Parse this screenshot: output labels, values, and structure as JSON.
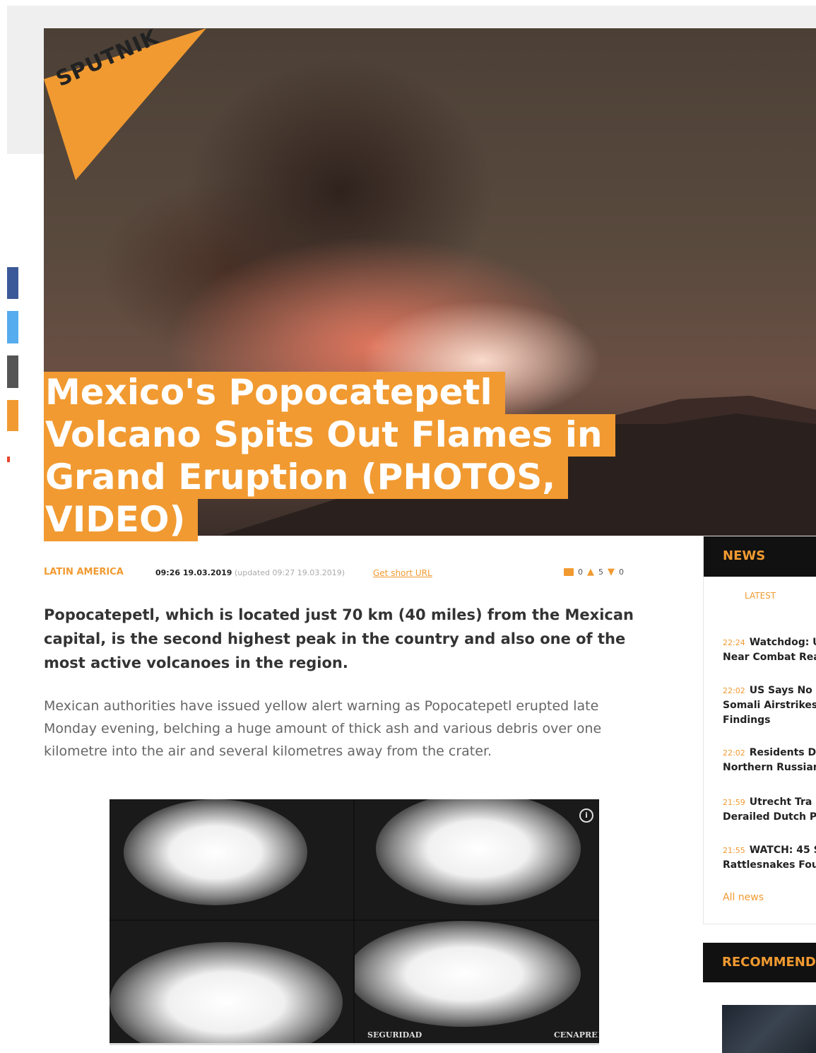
{
  "brand": {
    "logo_text": "SPUTNIK",
    "accent": "#f19a31"
  },
  "article": {
    "headline_lines": [
      "Mexico's Popocatepetl",
      "Volcano Spits Out Flames in",
      "Grand Eruption (PHOTOS,",
      "VIDEO)"
    ],
    "category": "LATIN AMERICA",
    "published": "09:26 19.03.2019",
    "updated": "(updated 09:27 19.03.2019)",
    "short_url": "Get short URL",
    "counters": {
      "comments": "0",
      "likes": "5",
      "dislikes": "0"
    },
    "lead": "Popocatepetl, which is located just 70 km (40 miles) from the Mexican capital, is the second highest peak in the country and also one of the most active volcanoes in the region.",
    "body": "Mexican authorities have issued yellow alert warning as Popocatepetl erupted late Monday evening, belching a huge amount of thick ash and various debris over one kilometre into the air and several kilometres away from the crater.",
    "gallery": {
      "captions": [
        "SEGURIDAD",
        "CENAPRED"
      ]
    }
  },
  "share_colors": [
    "#3b5998",
    "#55acee",
    "#555555",
    "#f19a31",
    "#e8442b"
  ],
  "sidebar": {
    "news_title": "NEWS",
    "tab_latest": "LATEST",
    "items": [
      {
        "time": "22:24",
        "line1": "Watchdog: U",
        "line2": "Near Combat Rea"
      },
      {
        "time": "22:02",
        "line1": "US Says No",
        "line2": "Somali Airstrikes",
        "line3": "Findings"
      },
      {
        "time": "22:02",
        "line1": "Residents D",
        "line2": "Northern Russian"
      },
      {
        "time": "21:59",
        "line1": "Utrecht Tra",
        "line2": "Derailed Dutch P"
      },
      {
        "time": "21:55",
        "line1": "WATCH: 45 S",
        "line2": "Rattlesnakes Fou"
      }
    ],
    "all_news": "All news",
    "recommend_title": "RECOMMEND"
  }
}
